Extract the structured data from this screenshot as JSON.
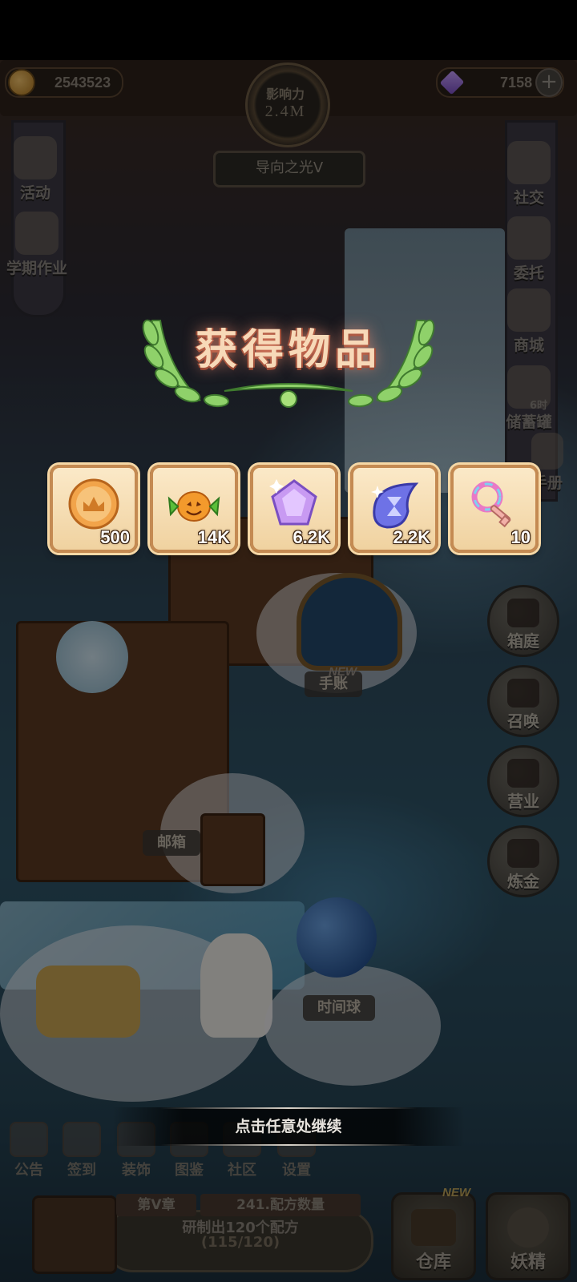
{
  "top_bar": {
    "gold": "2543523",
    "gems": "7158",
    "influence_label": "影响力",
    "influence_value": "2.4M",
    "rank_title": "导向之光V"
  },
  "left_menu": [
    {
      "label": "活动",
      "icon": "activity-icon"
    },
    {
      "label": "学期作业",
      "icon": "homework-scroll-icon"
    }
  ],
  "right_menu": [
    {
      "label": "社交",
      "icon": "social-icon"
    },
    {
      "label": "委托",
      "icon": "commission-icon"
    },
    {
      "label": "商城",
      "icon": "shop-icon"
    },
    {
      "label": "储蓄罐",
      "badge": "6时",
      "icon": "piggy-bank-icon"
    },
    {
      "label": "手册",
      "icon": "handbook-icon"
    }
  ],
  "right_round_buttons": [
    {
      "label": "箱庭",
      "icon": "garden-icon"
    },
    {
      "label": "召唤",
      "icon": "summon-icon"
    },
    {
      "label": "营业",
      "icon": "business-icon"
    },
    {
      "label": "炼金",
      "icon": "cauldron-icon"
    }
  ],
  "scene_labels": {
    "journal": "手账",
    "journal_new": "NEW",
    "mailbox": "邮箱",
    "time_orb": "时间球"
  },
  "popup": {
    "title": "获得物品",
    "continue_hint": "点击任意处继续",
    "rewards": [
      {
        "icon": "influence-coin-icon",
        "amount": "500"
      },
      {
        "icon": "pumpkin-candy-icon",
        "amount": "14K"
      },
      {
        "icon": "purple-gem-icon",
        "amount": "6.2K"
      },
      {
        "icon": "hourglass-crystal-icon",
        "amount": "2.2K"
      },
      {
        "icon": "rainbow-key-icon",
        "amount": "10"
      }
    ]
  },
  "bottom_nav": [
    {
      "label": "公告",
      "icon": "announcement-icon"
    },
    {
      "label": "签到",
      "icon": "checkin-icon"
    },
    {
      "label": "装饰",
      "icon": "decoration-icon"
    },
    {
      "label": "图鉴",
      "icon": "gallery-icon"
    },
    {
      "label": "社区",
      "icon": "community-icon"
    },
    {
      "label": "设置",
      "icon": "settings-icon"
    }
  ],
  "quest": {
    "chapter": "第V章",
    "recipe_count": "241.配方数量",
    "goal": "研制出120个配方",
    "progress": "(115/120)",
    "progress_fraction": 0.958
  },
  "bottom_buttons": {
    "warehouse": "仓库",
    "warehouse_new": "NEW",
    "fairy": "妖精"
  },
  "colors": {
    "reward_frame": "#c48a52",
    "reward_bg": "#fbe9c8",
    "title_glow": "#f7d9b8",
    "laurel": "#8fd16a"
  }
}
